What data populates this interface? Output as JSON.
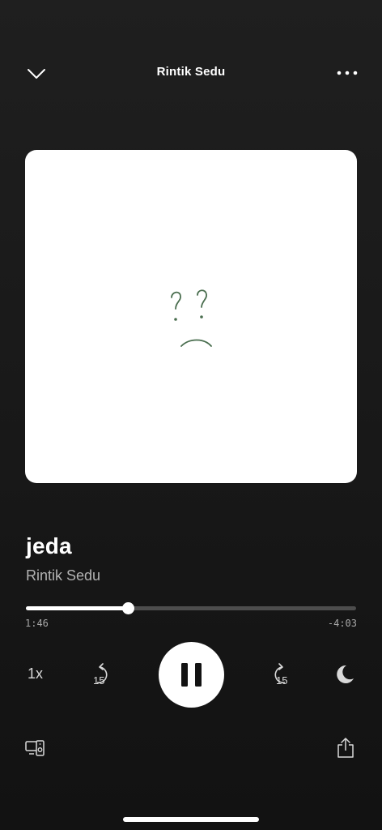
{
  "header": {
    "collapse_icon": "chevron-down-icon",
    "title": "Rintik Sedu",
    "more_icon": "more-dots-icon"
  },
  "artwork": {
    "description_icon": "question-frown-doodle",
    "background_color": "#ffffff",
    "doodle_color": "#4a6e4f"
  },
  "track": {
    "title": "jeda",
    "artist": "Rintik Sedu"
  },
  "playback": {
    "elapsed": "1:46",
    "remaining": "-4:03",
    "progress_fraction": 0.31
  },
  "controls": {
    "speed_label": "1x",
    "skip_back_icon": "rewind-15-icon",
    "skip_back_label": "15",
    "play_pause_icon": "pause-icon",
    "skip_forward_icon": "forward-15-icon",
    "skip_forward_label": "15",
    "sleep_timer_icon": "moon-icon"
  },
  "bottom_bar": {
    "devices_icon": "connect-device-icon",
    "share_icon": "share-icon"
  },
  "colors": {
    "background": "#121212",
    "text_primary": "#ffffff",
    "text_secondary": "#b3b3b3",
    "track_inactive": "#4d4d4d"
  }
}
